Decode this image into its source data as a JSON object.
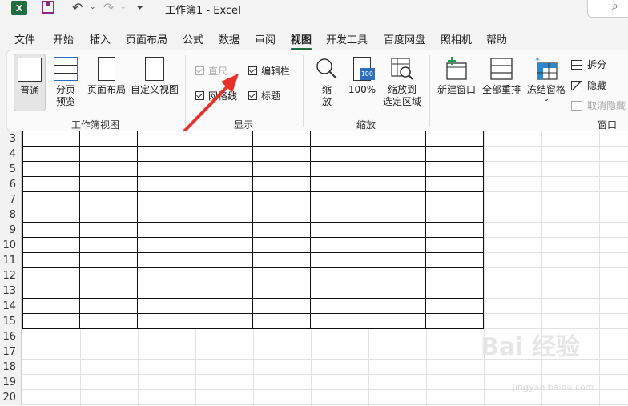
{
  "titlebar": {
    "logo_letter": "X",
    "title": "工作簿1  -  Excel",
    "search_icon": "search-icon"
  },
  "menu": {
    "tabs": [
      "文件",
      "开始",
      "插入",
      "页面布局",
      "公式",
      "数据",
      "审阅",
      "视图",
      "开发工具",
      "百度网盘",
      "照相机",
      "帮助"
    ],
    "active": "视图"
  },
  "ribbon": {
    "workbook_views": {
      "label": "工作簿视图",
      "normal": "普通",
      "page_break_line1": "分页",
      "page_break_line2": "预览",
      "page_layout": "页面布局",
      "custom": "自定义视图"
    },
    "show": {
      "label": "显示",
      "ruler": "直尺",
      "formula_bar": "编辑栏",
      "gridlines": "网格线",
      "headings": "标题",
      "ruler_checked": true,
      "formula_bar_checked": true,
      "gridlines_checked": true,
      "headings_checked": true
    },
    "zoom": {
      "label": "缩放",
      "zoom_line1": "缩",
      "zoom_line2": "放",
      "hundred": "100%",
      "hundred_badge": "100",
      "to_selection_line1": "缩放到",
      "to_selection_line2": "选定区域"
    },
    "window": {
      "label": "窗口",
      "new_window": "新建窗口",
      "arrange_all": "全部重排",
      "freeze": "冻结窗格",
      "split": "拆分",
      "hide": "隐藏",
      "unhide": "取消隐藏"
    }
  },
  "sheet": {
    "row_numbers": [
      "3",
      "4",
      "5",
      "6",
      "7",
      "8",
      "9",
      "10",
      "11",
      "12",
      "13",
      "14",
      "15",
      "16",
      "17",
      "18",
      "19",
      "20"
    ],
    "table_rows": 13,
    "table_cols": 8
  },
  "watermark": {
    "text": "Bai 经验",
    "url": "jingyan.baidu.com"
  },
  "colors": {
    "accent": "#1e6e42",
    "arrow": "#e8302a"
  }
}
